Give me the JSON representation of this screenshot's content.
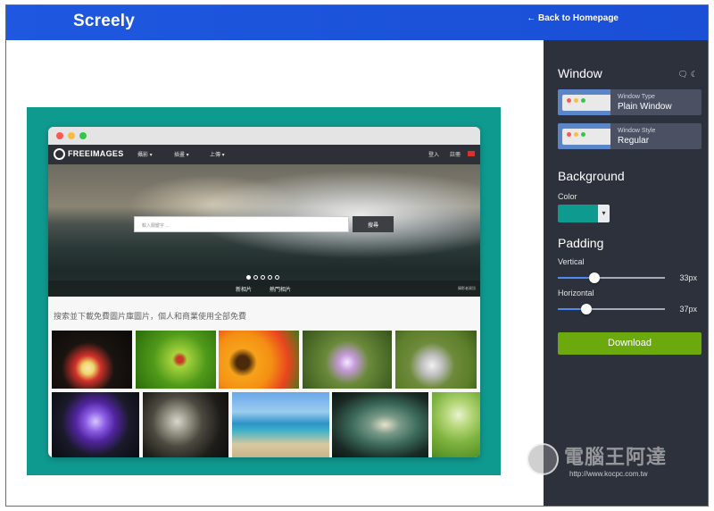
{
  "header": {
    "brand": "Screely",
    "back_link": "← Back to Homepage"
  },
  "preview": {
    "background_color": "#0f9a90",
    "site": {
      "name": "FREEIMAGES",
      "menu": [
        "攝影 ▾",
        "插畫 ▾",
        "上傳 ▾"
      ],
      "menu_right": [
        "登入",
        "註冊"
      ],
      "search_placeholder": "輸入關鍵字 ...",
      "search_button": "搜尋",
      "hero_tabs": [
        "新相片",
        "熱門相片"
      ],
      "hero_credit": "攝影者資訊",
      "tagline": "搜索並下載免費圖片庫圖片，個人和商業使用全部免費"
    }
  },
  "panel": {
    "window": {
      "title": "Window",
      "icons": [
        "comment-icon",
        "moon-icon"
      ],
      "options": [
        {
          "label": "Window Type",
          "value": "Plain Window"
        },
        {
          "label": "Window Style",
          "value": "Regular"
        }
      ]
    },
    "background": {
      "title": "Background",
      "color_label": "Color",
      "color": "#0f9a90",
      "dropdown_glyph": "▾"
    },
    "padding": {
      "title": "Padding",
      "vertical": {
        "label": "Vertical",
        "value": "33px",
        "level": 0.34
      },
      "horizontal": {
        "label": "Horizontal",
        "value": "37px",
        "level": 0.27
      }
    },
    "download_label": "Download"
  },
  "watermark": {
    "text": "電腦王阿達",
    "url": "http://www.kocpc.com.tw"
  }
}
